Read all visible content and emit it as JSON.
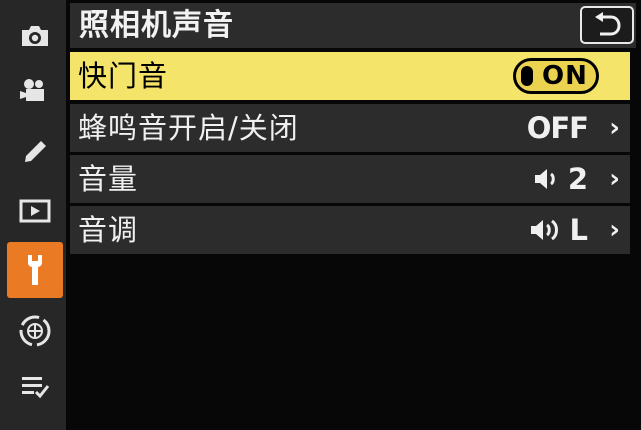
{
  "sidebar": {
    "items": [
      {
        "icon": "camera-icon",
        "active": false
      },
      {
        "icon": "movie-camera-icon",
        "active": false
      },
      {
        "icon": "pencil-icon",
        "active": false
      },
      {
        "icon": "playback-icon",
        "active": false
      },
      {
        "icon": "wrench-icon",
        "active": true
      },
      {
        "icon": "network-icon",
        "active": false
      },
      {
        "icon": "my-menu-icon",
        "active": false
      }
    ],
    "active_color": "#ea7a23"
  },
  "header": {
    "title": "照相机声音",
    "back_icon": "return-arrow-icon"
  },
  "menu": {
    "items": [
      {
        "label": "快门音",
        "value": "ON",
        "type": "toggle",
        "selected": true
      },
      {
        "label": "蜂鸣音开启/关闭",
        "value": "OFF",
        "type": "submenu",
        "selected": false
      },
      {
        "label": "音量",
        "value": "2",
        "icon": "speaker-icon",
        "type": "submenu",
        "selected": false
      },
      {
        "label": "音调",
        "value": "L",
        "icon": "speaker-loud-icon",
        "type": "submenu",
        "selected": false
      }
    ],
    "chevron": "›",
    "highlight_color": "#f5e46a"
  }
}
